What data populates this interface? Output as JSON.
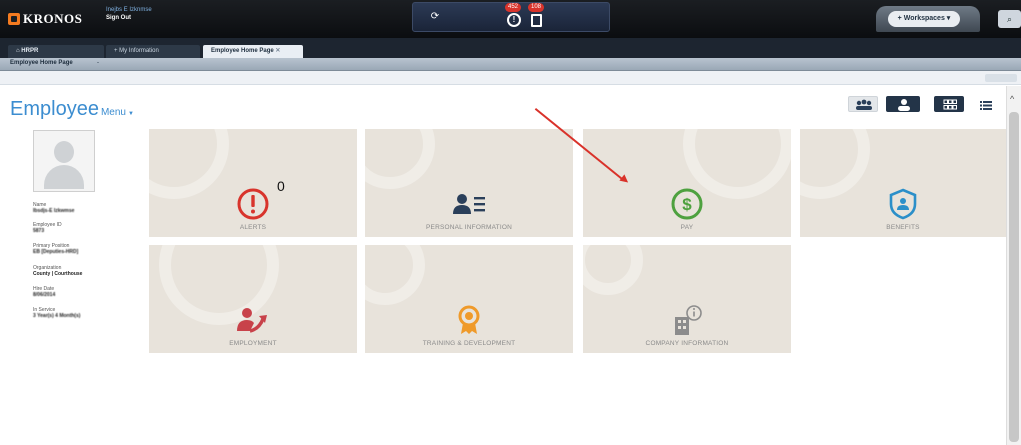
{
  "app": {
    "logo": "KRONOS",
    "user_name": "Inejbs E Izknmse",
    "sign_out": "Sign Out",
    "alert_count": "452",
    "note_count": "108",
    "workspaces": "Workspaces"
  },
  "tabs": {
    "hrpr": "HRPR",
    "my_information": "My Information",
    "employee_home": "Employee Home Page"
  },
  "subbar": {
    "title": "Employee Home Page",
    "dropdown": "-"
  },
  "header": {
    "title": "Employee",
    "menu": "Menu"
  },
  "profile": {
    "name_label": "Name",
    "name_value": "Ibsdjs-E Izkwmse",
    "employee_id_label": "Employee ID",
    "employee_id_value": "5873",
    "primary_position_label": "Primary Position",
    "primary_position_value": "EB [Deputies-HRD]",
    "organization_label": "Organization",
    "organization_value": "County | Courthouse",
    "hire_date_label": "Hire Date",
    "hire_date_value": "8/06/2014",
    "in_service_label": "In Service",
    "in_service_value": "3 Year(s) 4 Month(s)"
  },
  "tiles": [
    {
      "label": "ALERTS",
      "count": "0"
    },
    {
      "label": "PERSONAL INFORMATION"
    },
    {
      "label": "PAY"
    },
    {
      "label": "BENEFITS"
    },
    {
      "label": "EMPLOYMENT"
    },
    {
      "label": "TRAINING & DEVELOPMENT"
    },
    {
      "label": "COMPANY INFORMATION"
    }
  ],
  "colors": {
    "alert_red": "#d8342c",
    "personal_navy": "#2a3f5a",
    "pay_green": "#4ea13f",
    "benefits_blue": "#2b8fc9",
    "employment_red": "#c8424a",
    "training_orange": "#ef9a2a",
    "company_gray": "#8c8c8c",
    "tile_bg": "#e8e3db"
  }
}
